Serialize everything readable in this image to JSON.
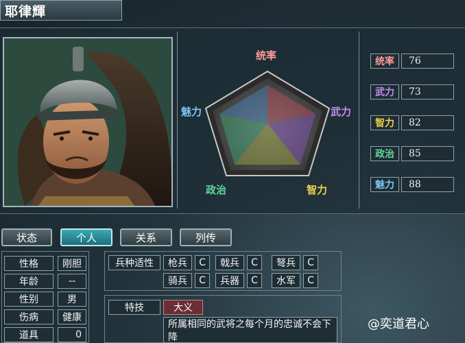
{
  "officer": {
    "name": "耶律輝"
  },
  "radar": {
    "labels": {
      "top": "统率",
      "right": "武力",
      "bottom_right": "智力",
      "bottom_left": "政治",
      "left": "魅力"
    },
    "colors": {
      "top": "#ff9a9a",
      "right": "#c48cf0",
      "bottom_right": "#f0d24a",
      "bottom_left": "#63d69a",
      "left": "#7ec4f2"
    }
  },
  "stats": [
    {
      "label": "统率",
      "value": "76",
      "color": "#ff9a9a"
    },
    {
      "label": "武力",
      "value": "73",
      "color": "#c48cf0"
    },
    {
      "label": "智力",
      "value": "82",
      "color": "#f0d24a"
    },
    {
      "label": "政治",
      "value": "85",
      "color": "#63d69a"
    },
    {
      "label": "魅力",
      "value": "88",
      "color": "#7ec4f2"
    }
  ],
  "tabs": [
    "状态",
    "个人",
    "关系",
    "列传"
  ],
  "personal": [
    {
      "label": "性格",
      "value": "刚胆"
    },
    {
      "label": "年龄",
      "value": "--"
    },
    {
      "label": "性别",
      "value": "男"
    },
    {
      "label": "伤病",
      "value": "健康"
    },
    {
      "label": "道具",
      "value": "0"
    }
  ],
  "troops": {
    "header": "兵种适性",
    "items": [
      {
        "name": "枪兵",
        "grade": "C"
      },
      {
        "name": "戟兵",
        "grade": "C"
      },
      {
        "name": "弩兵",
        "grade": "C"
      },
      {
        "name": "骑兵",
        "grade": "C"
      },
      {
        "name": "兵器",
        "grade": "C"
      },
      {
        "name": "水军",
        "grade": "C"
      }
    ]
  },
  "skill": {
    "header": "特技",
    "name": "大义",
    "description": "所属相同的武将之每个月的忠诚不会下降"
  },
  "watermark": "@奕道君心"
}
